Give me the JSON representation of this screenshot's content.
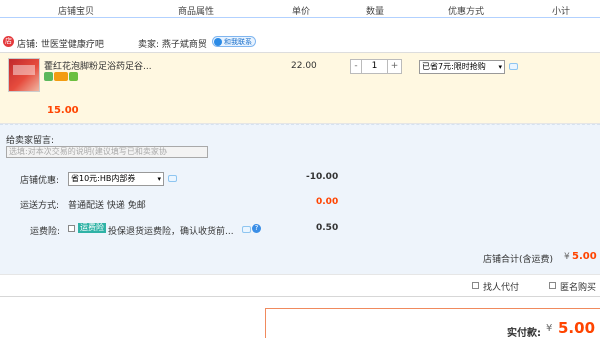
{
  "header": {
    "col_shop_item": "店铺宝贝",
    "col_attrs": "商品属性",
    "col_price": "单价",
    "col_qty": "数量",
    "col_promo": "优惠方式",
    "col_subtotal": "小计"
  },
  "shop": {
    "icon_name": "shop-icon",
    "label": "店铺: 世医堂健康疗吧",
    "seller_label": "卖家: 燕子斌商贸",
    "contact_label": "和我联系"
  },
  "item": {
    "title": "藿红花泡脚粉足浴药足谷...",
    "price": "22.00",
    "quantity": "1",
    "minus": "-",
    "plus": "+",
    "promo_selected": "已省7元:限时抢购",
    "subtotal": "15.00"
  },
  "buyer_message": {
    "label": "给卖家留言:",
    "placeholder": "选填:对本次交易的说明(建议填写已和卖家协"
  },
  "shop_discount": {
    "label": "店铺优惠:",
    "selected": "省10元:HB内部券",
    "amount": "-10.00"
  },
  "shipping": {
    "label": "运送方式:",
    "desc": "普通配送 快递 免邮",
    "amount": "0.00"
  },
  "insurance": {
    "label": "运费险:",
    "tag": "运费险",
    "desc": "投保退货运费险，确认收货前...",
    "amount": "0.50"
  },
  "shop_total": {
    "label": "店铺合计(含运费)",
    "currency": "¥",
    "amount": "5.00"
  },
  "options": {
    "proxy_pay": "找人代付",
    "anonymous": "匿名购买"
  },
  "payment": {
    "label": "实付款:",
    "currency": "¥",
    "amount": "5.00"
  },
  "colors": {
    "accent_orange": "#f40",
    "header_border": "#b2d1ff",
    "item_bg": "#fff8e1",
    "lower_bg": "#eef4fb"
  }
}
